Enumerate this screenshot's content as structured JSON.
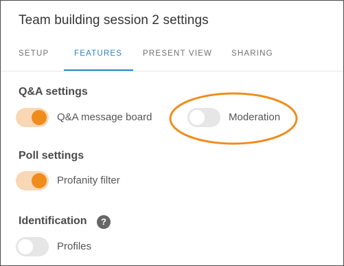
{
  "window": {
    "title": "Team building session 2 settings"
  },
  "tabs": [
    {
      "label": "SETUP",
      "active": false
    },
    {
      "label": "FEATURES",
      "active": true
    },
    {
      "label": "PRESENT VIEW",
      "active": false
    },
    {
      "label": "SHARING",
      "active": false
    }
  ],
  "qa_settings": {
    "title": "Q&A settings",
    "message_board": {
      "label": "Q&A message board",
      "on": true
    },
    "moderation": {
      "label": "Moderation",
      "on": false
    }
  },
  "poll_settings": {
    "title": "Poll settings",
    "profanity_filter": {
      "label": "Profanity filter",
      "on": true
    }
  },
  "identification": {
    "title": "Identification",
    "help_glyph": "?",
    "help_icon": "question-circle-icon",
    "profiles": {
      "label": "Profiles",
      "on": false
    }
  },
  "colors": {
    "accent": "#2a84c4",
    "toggle_on_knob": "#ef8c1c",
    "toggle_on_track": "#f8d7b5",
    "toggle_off_track": "#e6e6e6",
    "annotation": "#ef8c1c"
  }
}
